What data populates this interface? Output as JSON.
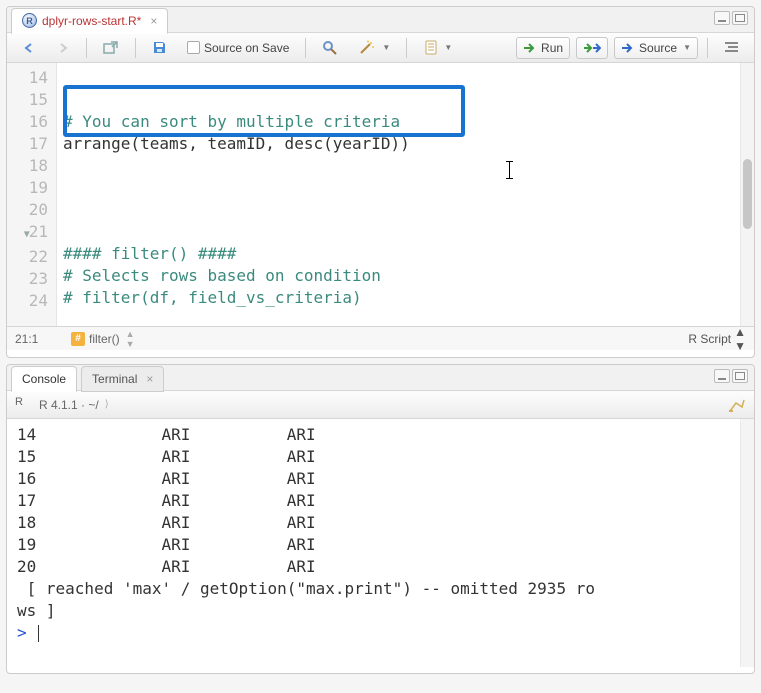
{
  "source": {
    "tab_name": "dplyr-rows-start.R*",
    "toolbar": {
      "source_on_save": "Source on Save",
      "run": "Run",
      "source": "Source"
    },
    "gutter": [
      "14",
      "15",
      "16",
      "17",
      "18",
      "19",
      "20",
      "21",
      "22",
      "23",
      "24"
    ],
    "code": {
      "l15": "# You can sort by multiple criteria",
      "l16": "arrange(teams, teamID, desc(yearID))",
      "l21": "#### filter() ####",
      "l22": "# Selects rows based on condition",
      "l23": "# filter(df, field_vs_criteria)"
    },
    "status": {
      "pos": "21:1",
      "crumb": "filter()",
      "lang": "R Script"
    }
  },
  "console": {
    "tabs": {
      "console": "Console",
      "terminal": "Terminal"
    },
    "header": "R 4.1.1 · ~/",
    "rows": [
      {
        "n": "14",
        "a": "ARI",
        "b": "ARI"
      },
      {
        "n": "15",
        "a": "ARI",
        "b": "ARI"
      },
      {
        "n": "16",
        "a": "ARI",
        "b": "ARI"
      },
      {
        "n": "17",
        "a": "ARI",
        "b": "ARI"
      },
      {
        "n": "18",
        "a": "ARI",
        "b": "ARI"
      },
      {
        "n": "19",
        "a": "ARI",
        "b": "ARI"
      },
      {
        "n": "20",
        "a": "ARI",
        "b": "ARI"
      }
    ],
    "truncation_a": " [ reached 'max' / getOption(\"max.print\") -- omitted 2935 ro",
    "truncation_b": "ws ]",
    "prompt": ">"
  }
}
